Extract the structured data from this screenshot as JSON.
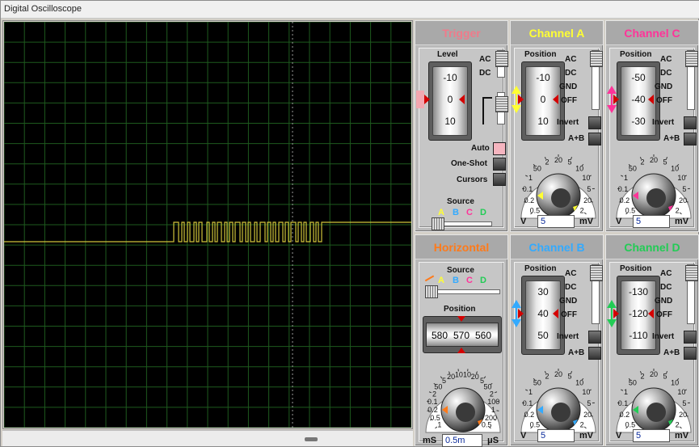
{
  "window": {
    "title": "Digital Oscilloscope"
  },
  "colors": {
    "trigger": "#f07a8a",
    "channel_a": "#ffff33",
    "channel_b": "#33aaff",
    "channel_c": "#ff3399",
    "channel_d": "#22cc55",
    "horizontal": "#ff7a1a",
    "trace": "#cfc23a",
    "grid": "#1e5a1e"
  },
  "trigger": {
    "title": "Trigger",
    "level_label": "Level",
    "drum": [
      "-10",
      "0",
      "10"
    ],
    "coupling": [
      "AC",
      "DC"
    ],
    "modes": [
      "Auto",
      "One-Shot",
      "Cursors"
    ],
    "source_label": "Source",
    "sources": [
      "A",
      "B",
      "C",
      "D"
    ]
  },
  "channel_a": {
    "title": "Channel A",
    "position_label": "Position",
    "drum": [
      "-10",
      "0",
      "10"
    ],
    "coupling": [
      "AC",
      "DC",
      "GND",
      "OFF"
    ],
    "invert": "Invert",
    "aplusb": "A+B",
    "scale": [
      "0.5",
      "0.2",
      "0.1",
      "1",
      "50",
      "2",
      "20",
      "5",
      "10",
      "10",
      "5",
      "20",
      "2"
    ],
    "unit_left": "V",
    "value": "5",
    "unit_right": "mV"
  },
  "channel_c": {
    "title": "Channel C",
    "position_label": "Position",
    "drum": [
      "-50",
      "-40",
      "-30"
    ],
    "coupling": [
      "AC",
      "DC",
      "GND",
      "OFF"
    ],
    "invert": "Invert",
    "aplusb": "A+B",
    "scale": [
      "0.5",
      "0.2",
      "0.1",
      "1",
      "50",
      "2",
      "20",
      "5",
      "10",
      "10",
      "5",
      "20",
      "2"
    ],
    "unit_left": "V",
    "value": "5",
    "unit_right": "mV"
  },
  "horizontal": {
    "title": "Horizontal",
    "source_label": "Source",
    "sources": [
      "A",
      "B",
      "C",
      "D"
    ],
    "position_label": "Position",
    "drum": [
      "580",
      "570",
      "560"
    ],
    "scale": [
      "1",
      "0.5",
      "0.2",
      "0.1",
      "2",
      "50",
      "5",
      "20",
      "10",
      "10",
      "20",
      "5",
      "50",
      "2",
      "100",
      "1",
      "200",
      "0.5"
    ],
    "unit_left": "mS",
    "value": "0.5m",
    "unit_right": "μS"
  },
  "channel_b": {
    "title": "Channel B",
    "position_label": "Position",
    "drum": [
      "30",
      "40",
      "50"
    ],
    "coupling": [
      "AC",
      "DC",
      "GND",
      "OFF"
    ],
    "invert": "Invert",
    "aplusb": "A+B",
    "scale": [
      "0.5",
      "0.2",
      "0.1",
      "1",
      "50",
      "2",
      "20",
      "5",
      "10",
      "10",
      "5",
      "20",
      "2"
    ],
    "unit_left": "V",
    "value": "5",
    "unit_right": "mV"
  },
  "channel_d": {
    "title": "Channel D",
    "position_label": "Position",
    "drum": [
      "-130",
      "-120",
      "-110"
    ],
    "coupling": [
      "AC",
      "DC",
      "GND",
      "OFF"
    ],
    "invert": "Invert",
    "aplusb": "A+B",
    "scale": [
      "0.5",
      "0.2",
      "0.1",
      "1",
      "50",
      "2",
      "20",
      "5",
      "10",
      "10",
      "5",
      "20",
      "2"
    ],
    "unit_left": "V",
    "value": "5",
    "unit_right": "mV"
  }
}
